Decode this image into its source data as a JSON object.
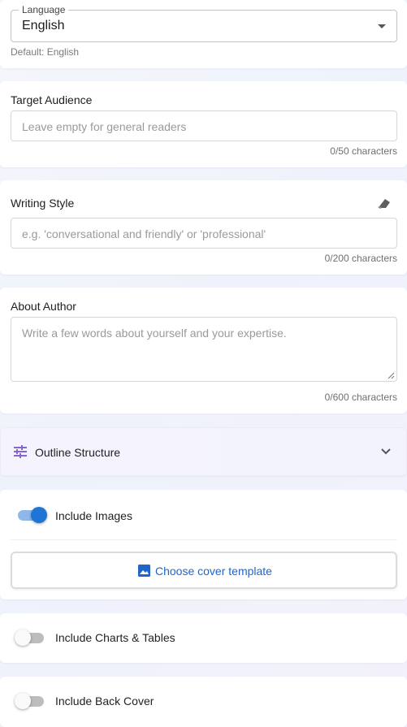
{
  "language": {
    "legend": "Language",
    "value": "English",
    "helper": "Default: English"
  },
  "audience": {
    "label": "Target Audience",
    "placeholder": "Leave empty for general readers",
    "counter": "0/50 characters"
  },
  "style": {
    "label": "Writing Style",
    "placeholder": "e.g. 'conversational and friendly' or 'professional'",
    "counter": "0/200 characters",
    "clear_icon": "eraser-icon"
  },
  "author": {
    "label": "About Author",
    "placeholder": "Write a few words about yourself and your expertise.",
    "counter": "0/600 characters"
  },
  "outline": {
    "title": "Outline Structure",
    "icon": "tune-icon",
    "expanded": false
  },
  "images": {
    "toggle_label": "Include Images",
    "enabled": true,
    "cover_button": "Choose cover template"
  },
  "charts": {
    "toggle_label": "Include Charts & Tables",
    "enabled": false
  },
  "back_cover": {
    "toggle_label": "Include Back Cover",
    "enabled": false
  },
  "colors": {
    "accent": "#1f74d6",
    "outline_icon": "#8a63d2",
    "link": "#1f66c7"
  }
}
